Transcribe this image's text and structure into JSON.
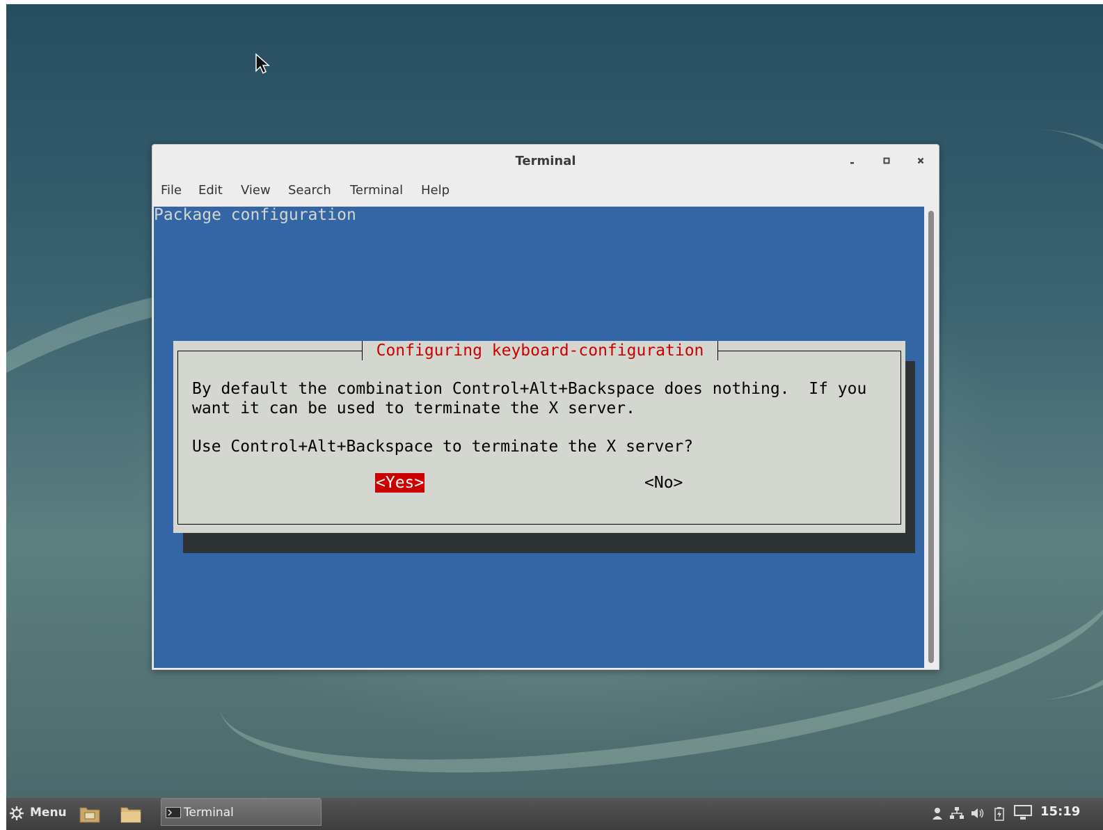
{
  "window": {
    "title": "Terminal",
    "menu": [
      "File",
      "Edit",
      "View",
      "Search",
      "Terminal",
      "Help"
    ]
  },
  "terminal": {
    "header": "Package configuration",
    "dialog": {
      "title": " Configuring keyboard-configuration ",
      "line1": "By default the combination Control+Alt+Backspace does nothing.  If you",
      "line2": "want it can be used to terminate the X server.",
      "question": "Use Control+Alt+Backspace to terminate the X server?",
      "yes": "<Yes>",
      "no": "<No>"
    }
  },
  "taskbar": {
    "menu_label": "Menu",
    "task_label": "Terminal",
    "clock": "15:19"
  },
  "icons": [
    "gear-icon",
    "file-manager-icon",
    "folder-icon",
    "terminal-icon",
    "user-icon",
    "network-icon",
    "volume-icon",
    "battery-icon",
    "display-icon"
  ],
  "colors": {
    "terminal_bg": "#3465a4",
    "dialog_bg": "#d3d7cf",
    "accent_red": "#cc0000"
  }
}
